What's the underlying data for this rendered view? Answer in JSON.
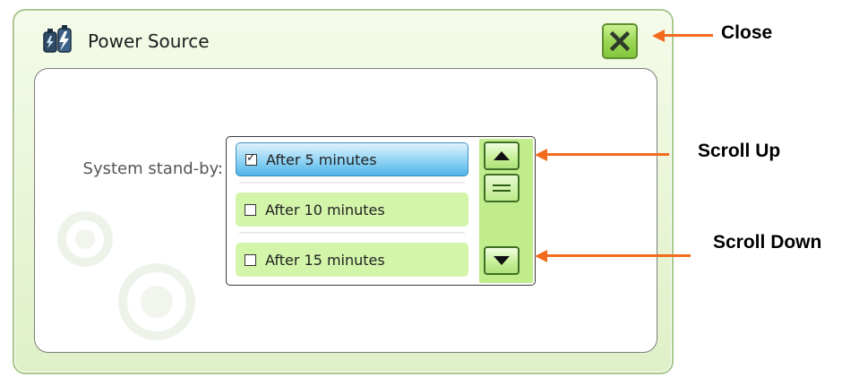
{
  "window": {
    "title": "Power Source",
    "close_icon": "close-x-icon",
    "title_icon": "power-battery-icon"
  },
  "settings": {
    "standby_label": "System stand-by:",
    "options": [
      {
        "label": "After 5 minutes",
        "checked": true
      },
      {
        "label": "After 10 minutes",
        "checked": false
      },
      {
        "label": "After 15 minutes",
        "checked": false
      }
    ],
    "scroll_up_icon": "triangle-up-icon",
    "scroll_down_icon": "triangle-down-icon",
    "scroll_thumb_icon": "scroll-thumb-grip-icon"
  },
  "annotations": {
    "close": "Close",
    "scroll_up": "Scroll Up",
    "scroll_down": "Scroll Down"
  },
  "colors": {
    "accent_green": "#98d552",
    "selected_blue": "#8fd3f4",
    "list_item_green": "#d3f5aa",
    "annotation_orange": "#f26b1d"
  }
}
